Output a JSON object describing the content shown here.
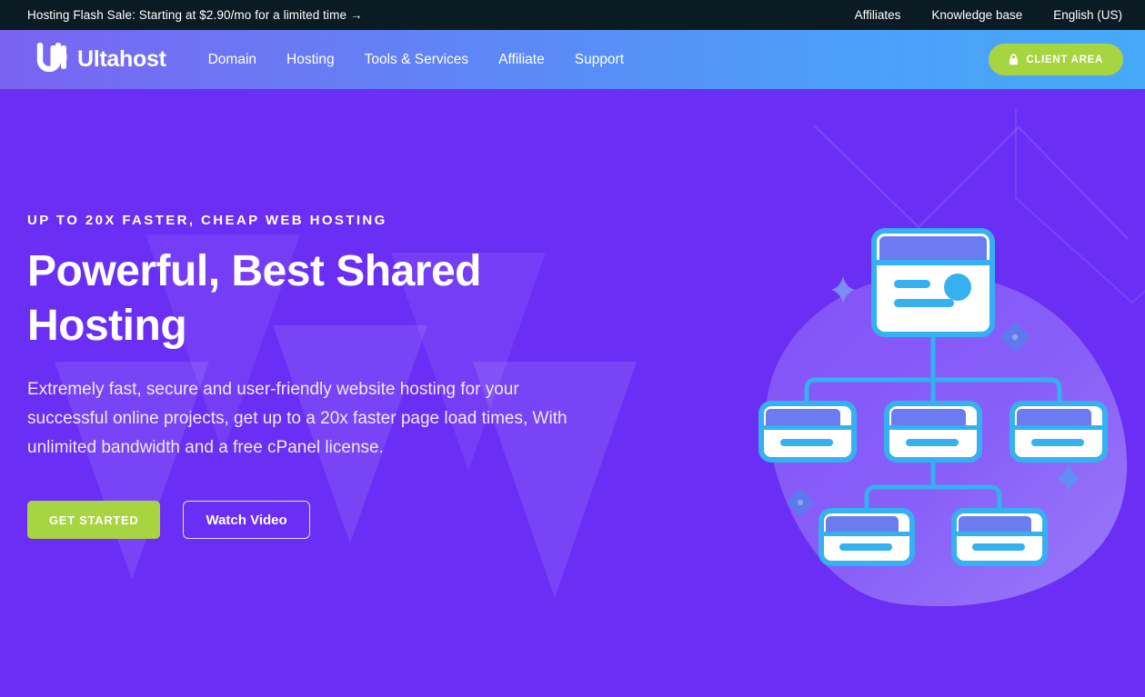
{
  "announcement": {
    "message": "Hosting Flash Sale: Starting at $2.90/mo for a limited time →",
    "links": [
      {
        "label": "Affiliates"
      },
      {
        "label": "Knowledge base"
      },
      {
        "label": "English (US)"
      }
    ]
  },
  "navbar": {
    "logo_text": "Ultahost",
    "logo_mark": "uh-monogram-icon",
    "links": [
      {
        "label": "Domain"
      },
      {
        "label": "Hosting"
      },
      {
        "label": "Tools & Services"
      },
      {
        "label": "Affiliate"
      },
      {
        "label": "Support"
      }
    ],
    "client_area": {
      "label": "CLIENT AREA",
      "icon": "lock-icon"
    }
  },
  "hero": {
    "eyebrow": "UP TO 20X FASTER, CHEAP WEB HOSTING",
    "headline": "Powerful, Best Shared Hosting",
    "subcopy": "Extremely fast, secure and user-friendly website hosting for your successful online projects, get up to a 20x faster page load times, With unlimited bandwidth and a free cPanel license.",
    "primary_cta": "GET STARTED",
    "secondary_cta": "Watch Video",
    "illustration": "hosting-sitemap-hierarchy-illustration"
  },
  "colors": {
    "announce_bg": "#0B1B23",
    "nav_gradient_start": "#7A63F2",
    "nav_gradient_end": "#46A9F9",
    "hero_bg": "#6A2EF5",
    "accent_green": "#A7D441",
    "illustration_blue": "#35B0F0",
    "illustration_periwinkle": "#6C7BF0",
    "text_white": "#FFFFFF"
  }
}
